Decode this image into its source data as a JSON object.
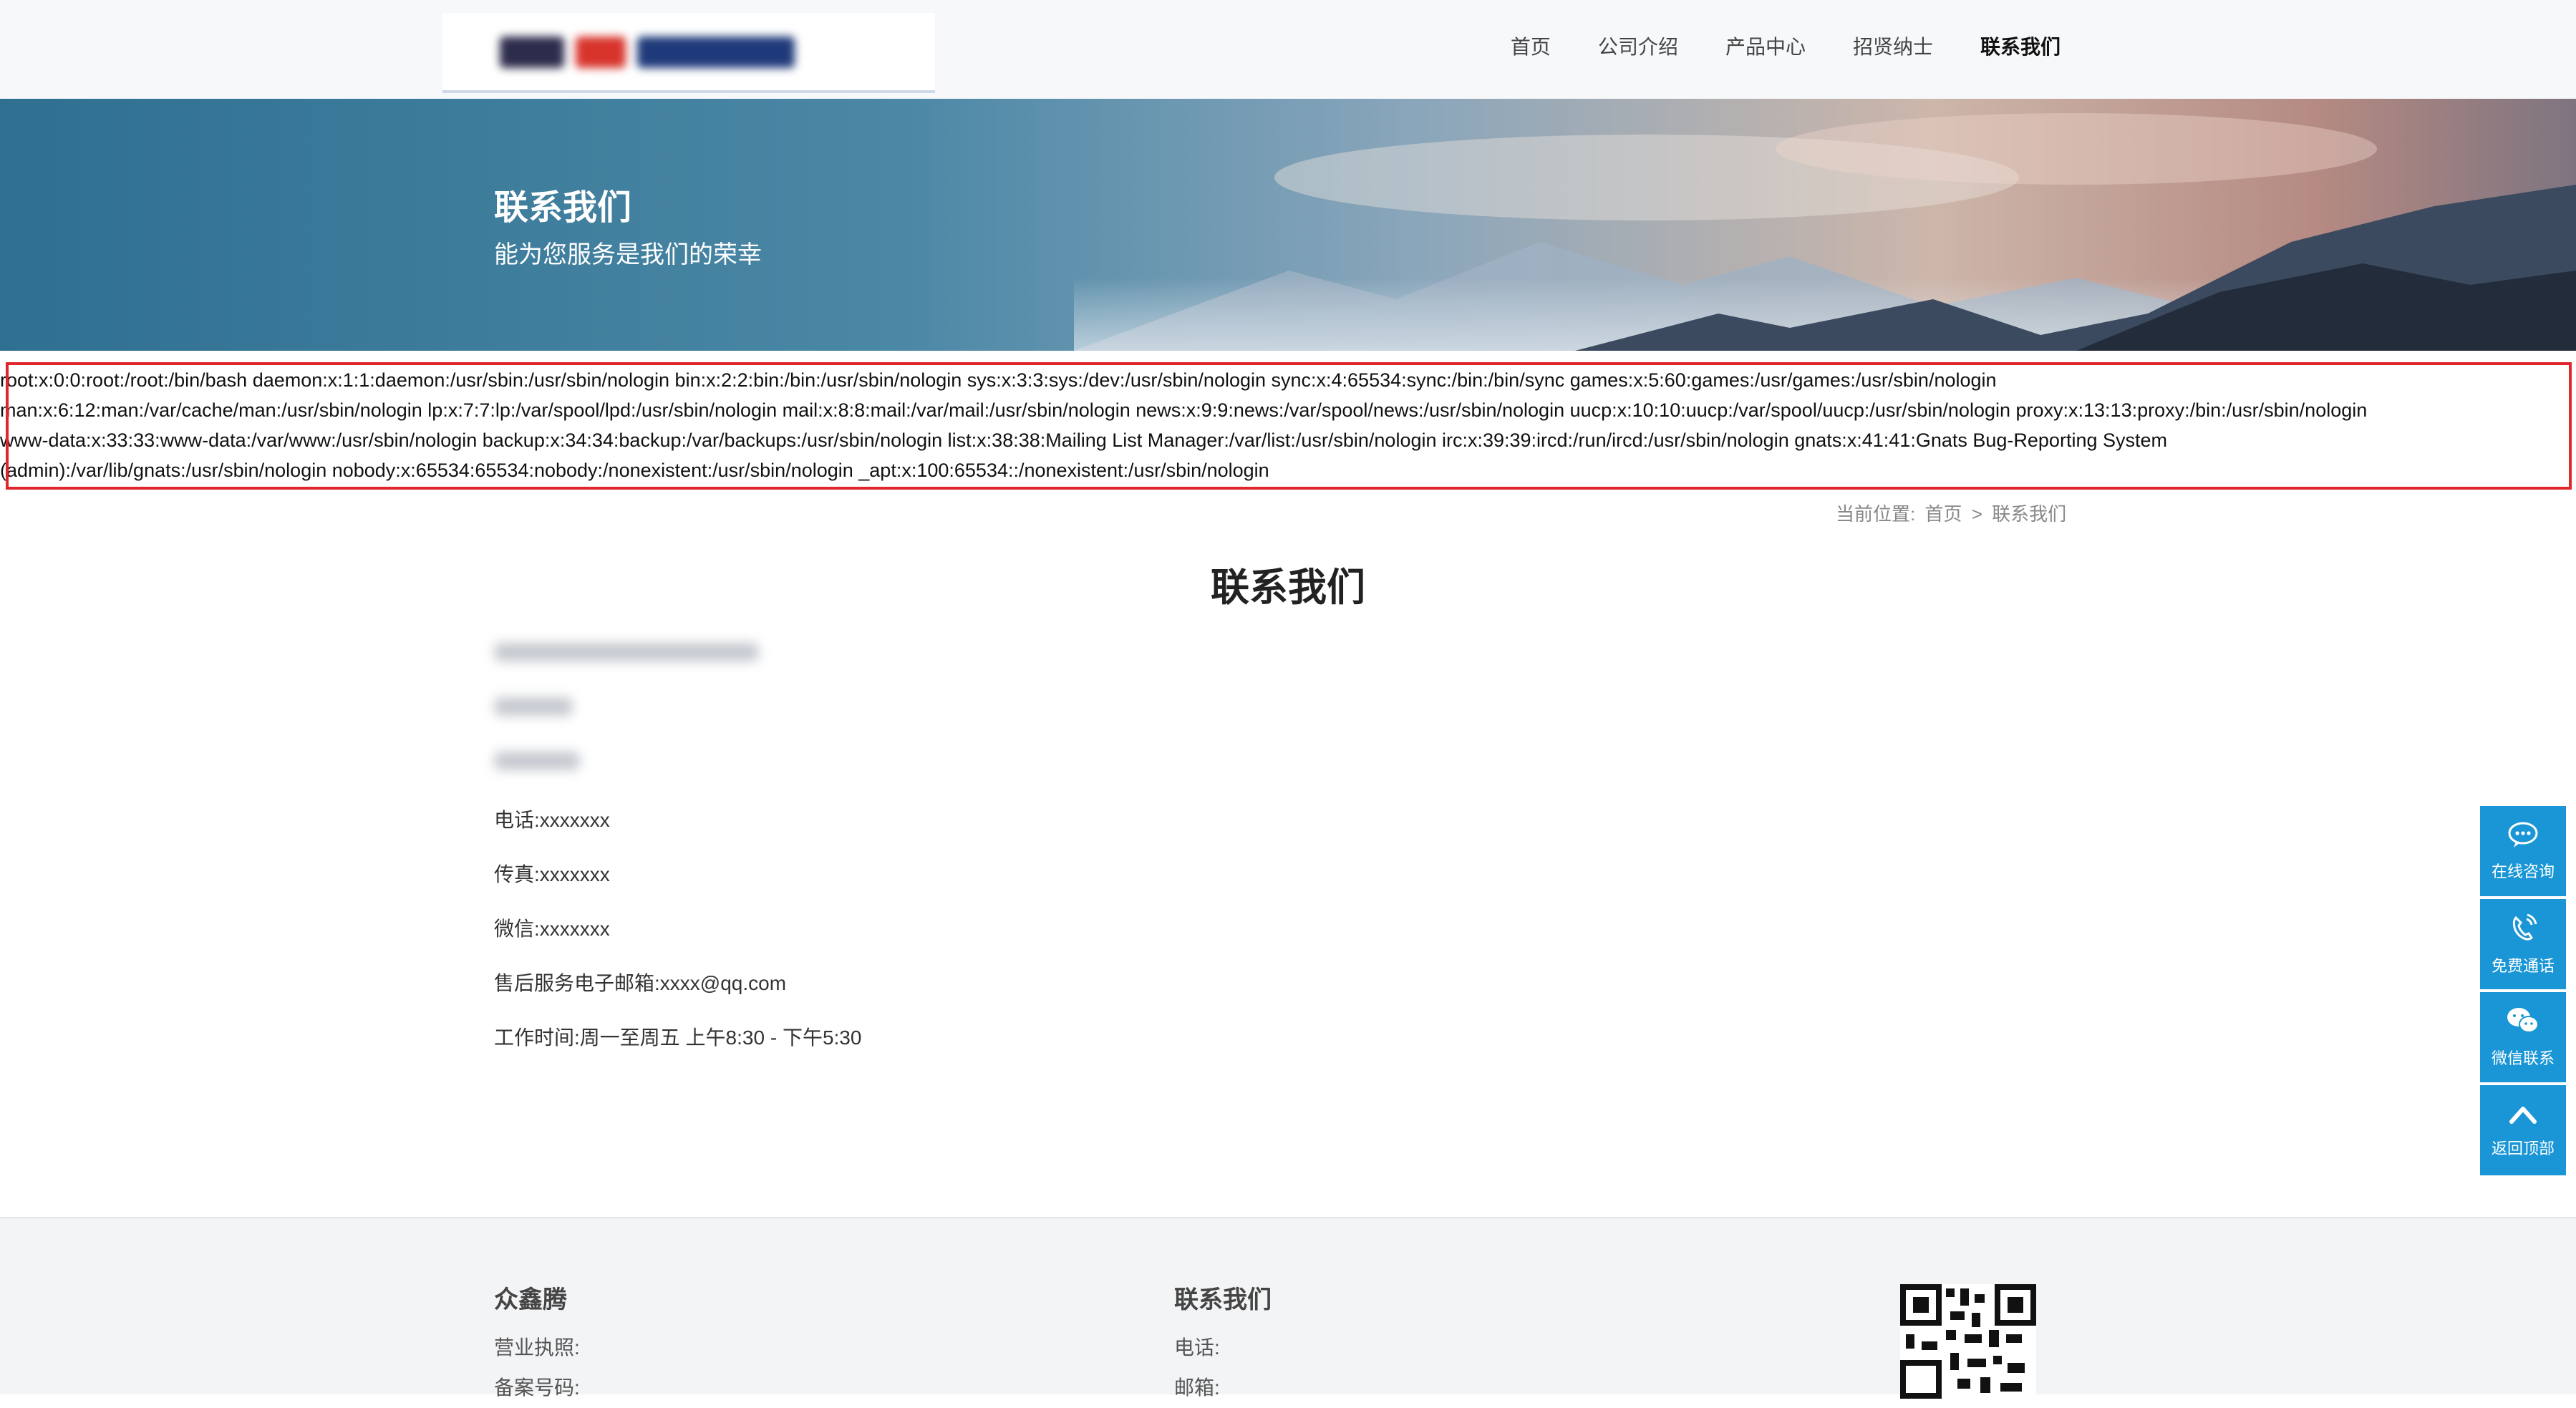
{
  "header": {
    "nav": [
      {
        "label": "首页",
        "active": false
      },
      {
        "label": "公司介绍",
        "active": false
      },
      {
        "label": "产品中心",
        "active": false
      },
      {
        "label": "招贤纳士",
        "active": false
      },
      {
        "label": "联系我们",
        "active": true
      }
    ]
  },
  "banner": {
    "title": "联系我们",
    "subtitle": "能为您服务是我们的荣幸"
  },
  "output": {
    "lines": [
      "root:x:0:0:root:/root:/bin/bash daemon:x:1:1:daemon:/usr/sbin:/usr/sbin/nologin bin:x:2:2:bin:/bin:/usr/sbin/nologin sys:x:3:3:sys:/dev:/usr/sbin/nologin sync:x:4:65534:sync:/bin:/bin/sync games:x:5:60:games:/usr/games:/usr/sbin/nologin",
      "man:x:6:12:man:/var/cache/man:/usr/sbin/nologin lp:x:7:7:lp:/var/spool/lpd:/usr/sbin/nologin mail:x:8:8:mail:/var/mail:/usr/sbin/nologin news:x:9:9:news:/var/spool/news:/usr/sbin/nologin uucp:x:10:10:uucp:/var/spool/uucp:/usr/sbin/nologin proxy:x:13:13:proxy:/bin:/usr/sbin/nologin",
      "www-data:x:33:33:www-data:/var/www:/usr/sbin/nologin backup:x:34:34:backup:/var/backups:/usr/sbin/nologin list:x:38:38:Mailing List Manager:/var/list:/usr/sbin/nologin irc:x:39:39:ircd:/run/ircd:/usr/sbin/nologin gnats:x:41:41:Gnats Bug-Reporting System",
      "(admin):/var/lib/gnats:/usr/sbin/nologin nobody:x:65534:65534:nobody:/nonexistent:/usr/sbin/nologin _apt:x:100:65534::/nonexistent:/usr/sbin/nologin"
    ]
  },
  "breadcrumb": {
    "prefix": "当前位置:",
    "home": "首页",
    "separator": ">",
    "current": "联系我们"
  },
  "main": {
    "title": "联系我们",
    "rows": [
      {
        "label": "电话:",
        "value": "xxxxxxx"
      },
      {
        "label": "传真:",
        "value": "xxxxxxx"
      },
      {
        "label": "微信:",
        "value": "xxxxxxx"
      },
      {
        "label": "售后服务电子邮箱:",
        "value": "xxxx@qq.com"
      },
      {
        "label": "工作时间:",
        "value": "周一至周五 上午8:30 - 下午5:30"
      }
    ]
  },
  "sidebar": [
    {
      "label": "在线咨询",
      "icon": "chat-bubble-icon"
    },
    {
      "label": "免费通话",
      "icon": "phone-icon"
    },
    {
      "label": "微信联系",
      "icon": "wechat-icon"
    },
    {
      "label": "返回顶部",
      "icon": "chevron-up-icon"
    }
  ],
  "footer": {
    "company": {
      "title": "众鑫腾",
      "license": "营业执照:",
      "record": "备案号码:"
    },
    "contact": {
      "title": "联系我们",
      "phone": "电话:",
      "email": "邮箱:"
    }
  },
  "colors": {
    "accent": "#1a96d6",
    "highlight": "#e0262c"
  }
}
